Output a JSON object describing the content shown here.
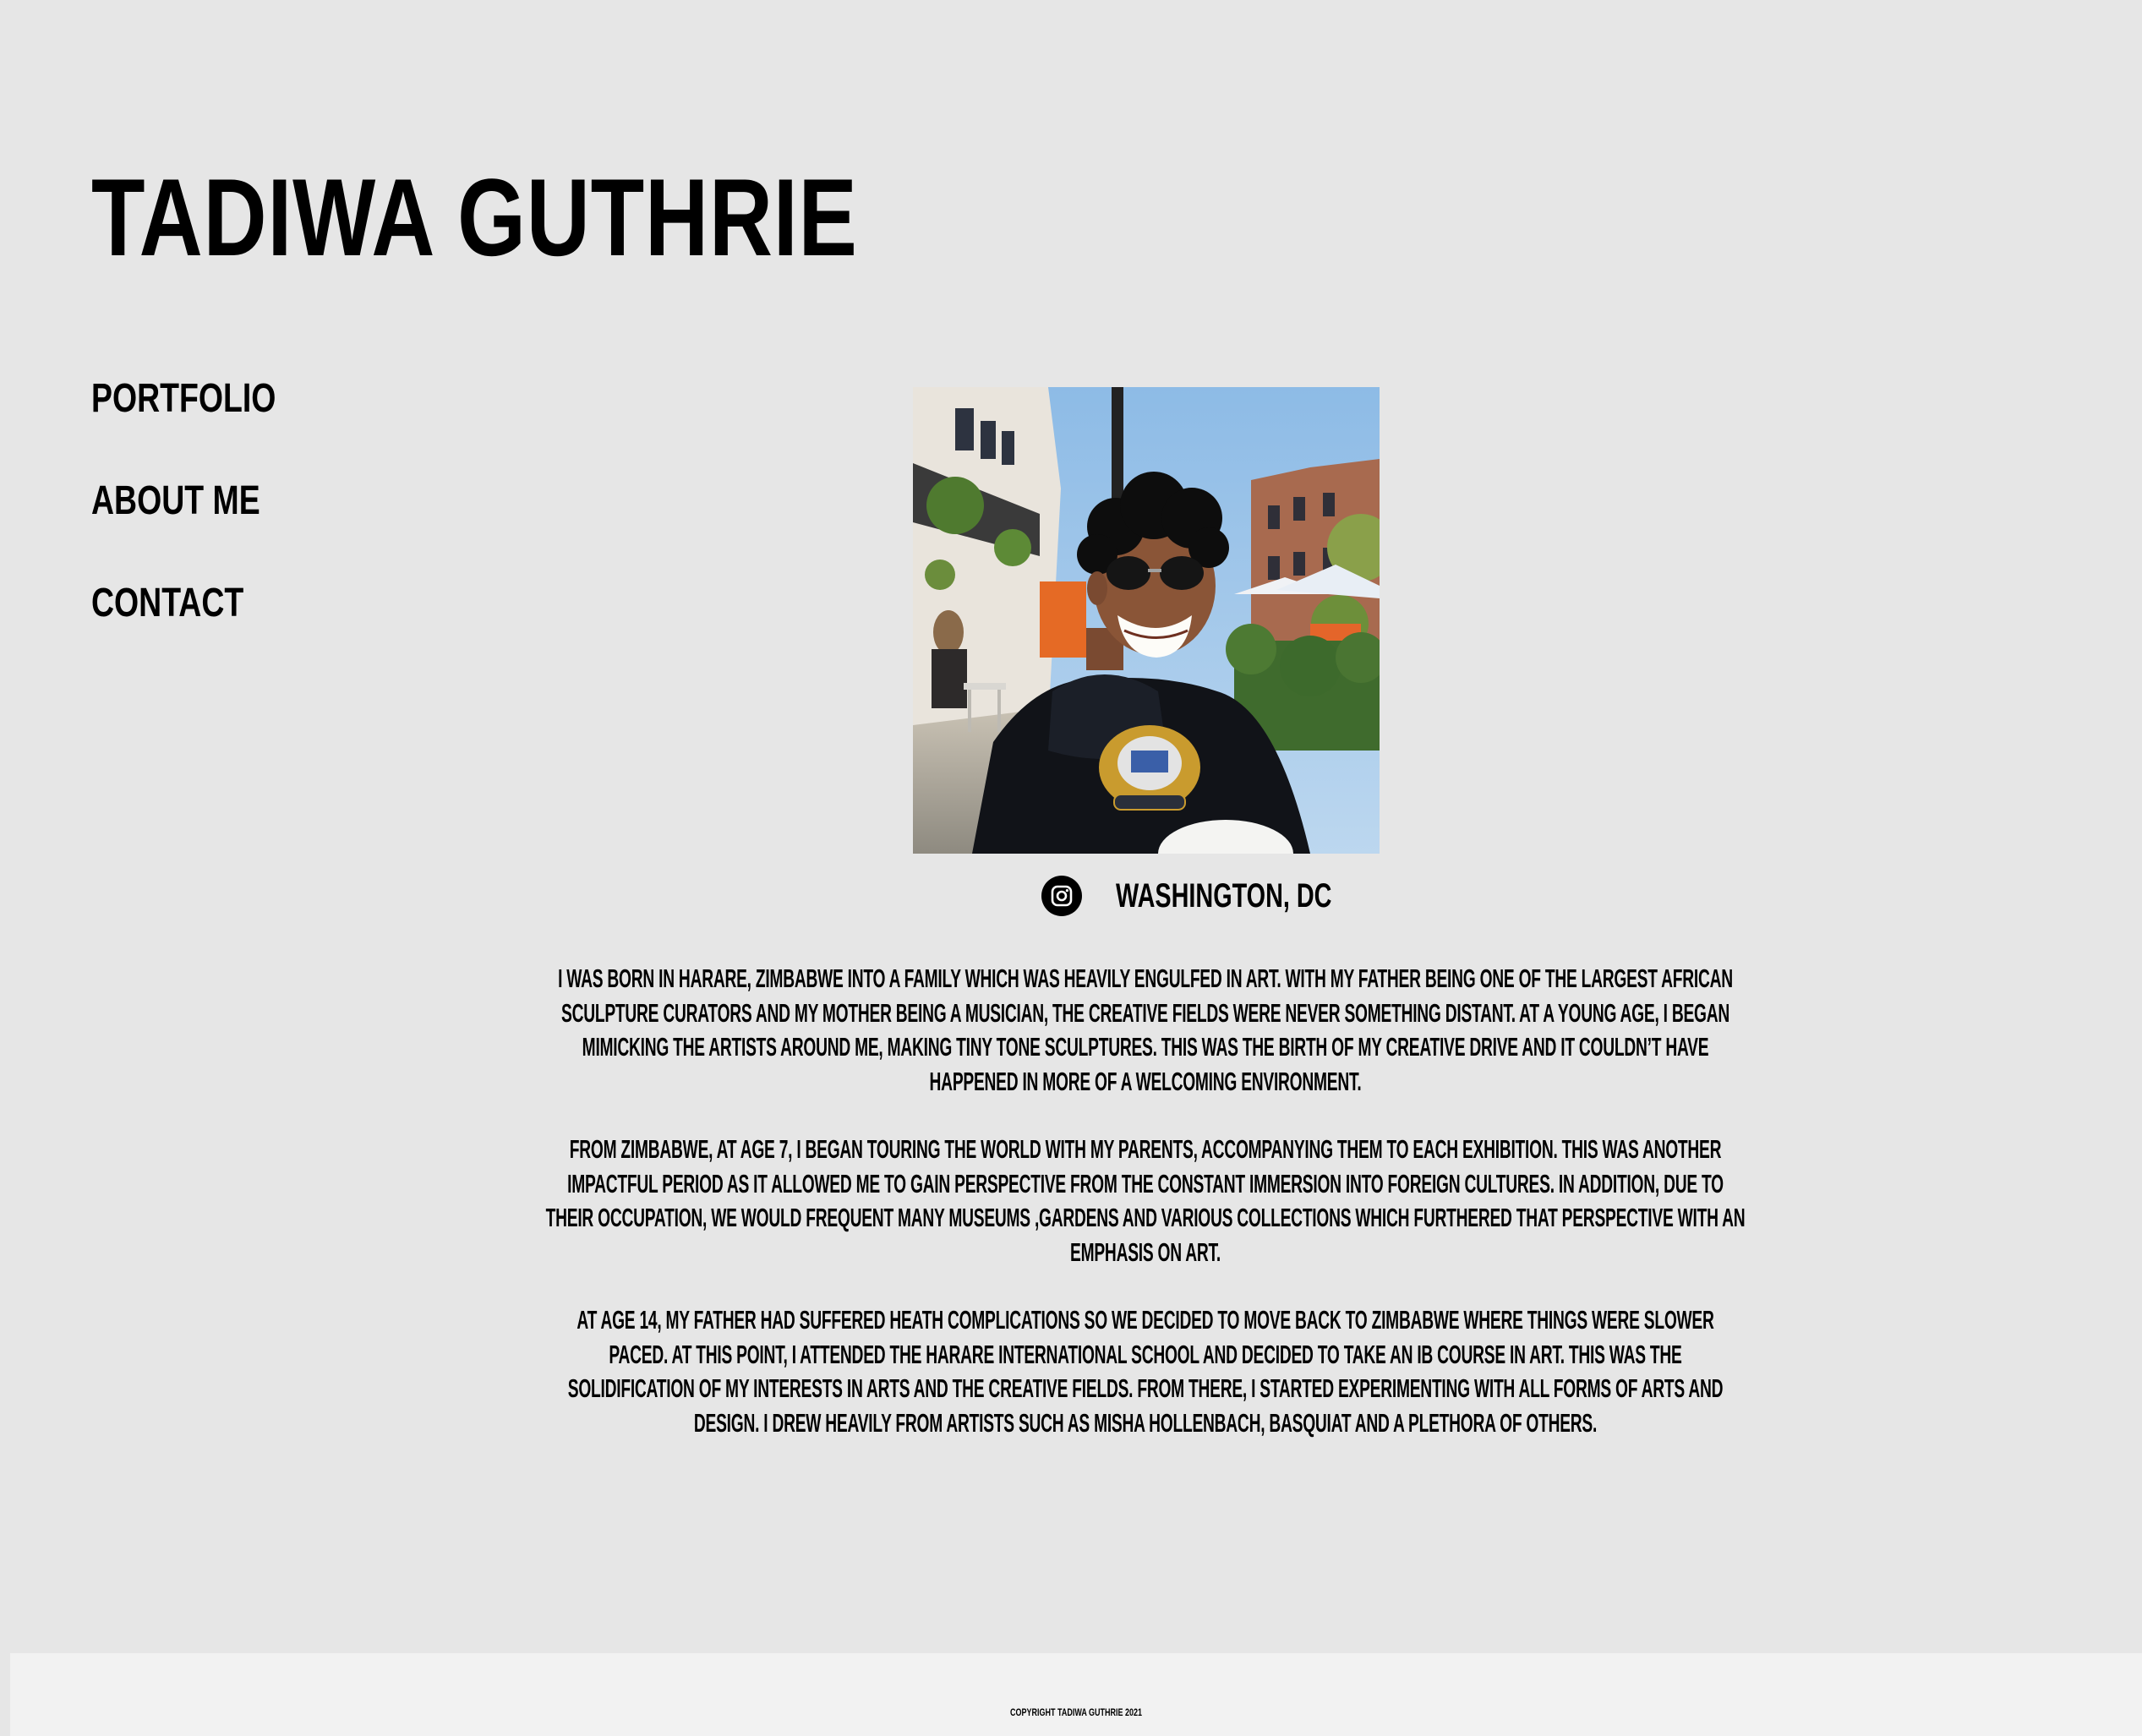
{
  "header": {
    "site_title": "TADIWA GUTHRIE"
  },
  "nav": {
    "items": [
      {
        "label": "PORTFOLIO"
      },
      {
        "label": "ABOUT ME"
      },
      {
        "label": "CONTACT"
      }
    ]
  },
  "profile": {
    "instagram_icon": "instagram-icon",
    "location": "WASHINGTON, DC"
  },
  "bio": {
    "paragraphs": [
      "I WAS BORN IN HARARE, ZIMBABWE INTO A FAMILY WHICH WAS HEAVILY ENGULFED IN ART. WITH MY FATHER BEING ONE OF THE LARGEST AFRICAN SCULPTURE CURATORS AND MY MOTHER BEING A MUSICIAN, THE CREATIVE FIELDS WERE NEVER SOMETHING DISTANT. AT A YOUNG AGE, I BEGAN MIMICKING THE ARTISTS AROUND ME, MAKING TINY TONE SCULPTURES. THIS WAS THE BIRTH OF MY CREATIVE DRIVE AND IT COULDN’T HAVE HAPPENED IN MORE OF A WELCOMING ENVIRONMENT.",
      "FROM ZIMBABWE, AT AGE 7, I BEGAN TOURING THE WORLD WITH MY PARENTS, ACCOMPANYING THEM TO EACH EXHIBITION. THIS WAS ANOTHER IMPACTFUL PERIOD AS IT ALLOWED ME TO GAIN PERSPECTIVE FROM THE CONSTANT IMMERSION INTO FOREIGN CULTURES. IN ADDITION, DUE TO THEIR OCCUPATION, WE WOULD FREQUENT MANY MUSEUMS ,GARDENS AND VARIOUS COLLECTIONS WHICH FURTHERED THAT PERSPECTIVE WITH AN EMPHASIS ON ART.",
      "AT AGE 14, MY FATHER HAD SUFFERED HEATH COMPLICATIONS SO WE DECIDED TO MOVE BACK TO ZIMBABWE WHERE THINGS WERE SLOWER PACED. AT THIS POINT, I ATTENDED THE HARARE INTERNATIONAL SCHOOL AND DECIDED TO TAKE AN IB COURSE IN ART. THIS WAS THE SOLIDIFICATION OF MY INTERESTS IN ARTS AND THE CREATIVE FIELDS. FROM THERE, I STARTED EXPERIMENTING WITH ALL FORMS OF ARTS AND DESIGN. I DREW HEAVILY FROM ARTISTS SUCH AS MISHA HOLLENBACH, BASQUIAT AND A PLETHORA OF OTHERS."
    ]
  },
  "footer": {
    "copyright": "COPYRIGHT TADIWA GUTHRIE 2021"
  },
  "colors": {
    "page_background": "#e6e6e6",
    "footer_background": "#f2f2f2",
    "text": "#000000"
  }
}
